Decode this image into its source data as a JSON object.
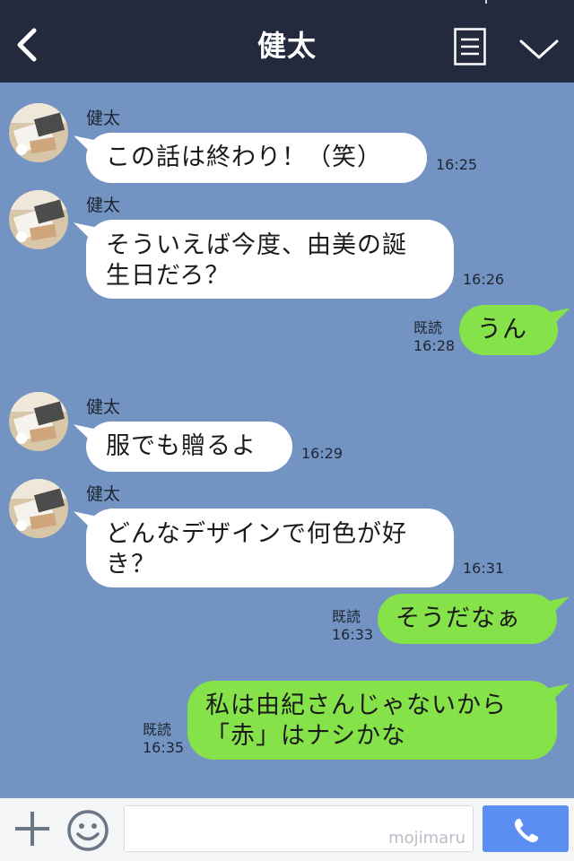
{
  "header": {
    "title": "健太"
  },
  "icons": {
    "back": "chevron-left-icon",
    "menu": "list-menu-icon",
    "expand": "chevron-down-icon",
    "add": "plus-icon",
    "emoji": "smiley-icon",
    "call": "phone-icon"
  },
  "colors": {
    "header_bg": "#232a3d",
    "chat_bg": "#7394c3",
    "incoming_bubble": "#ffffff",
    "outgoing_bubble": "#85e249",
    "call_button": "#5b8df2"
  },
  "messages": [
    {
      "direction": "in",
      "sender": "健太",
      "lines": [
        "この話は終わり！（笑）"
      ],
      "time": "16:25"
    },
    {
      "direction": "in",
      "sender": "健太",
      "lines": [
        "そういえば今度、由美の誕",
        "生日だろ？"
      ],
      "time": "16:26"
    },
    {
      "direction": "out",
      "lines": [
        "うん"
      ],
      "read": "既読",
      "time": "16:28"
    },
    {
      "direction": "in",
      "sender": "健太",
      "lines": [
        "服でも贈るよ"
      ],
      "time": "16:29"
    },
    {
      "direction": "in",
      "sender": "健太",
      "lines": [
        "どんなデザインで何色が好",
        "き？"
      ],
      "time": "16:31"
    },
    {
      "direction": "out",
      "lines": [
        "そうだなぁ"
      ],
      "read": "既読",
      "time": "16:33"
    },
    {
      "direction": "out",
      "lines": [
        "私は由紀さんじゃないから",
        "「赤」はナシかな"
      ],
      "read": "既読",
      "time": "16:35"
    }
  ],
  "input": {
    "placeholder": "",
    "watermark": "mojimaru"
  }
}
